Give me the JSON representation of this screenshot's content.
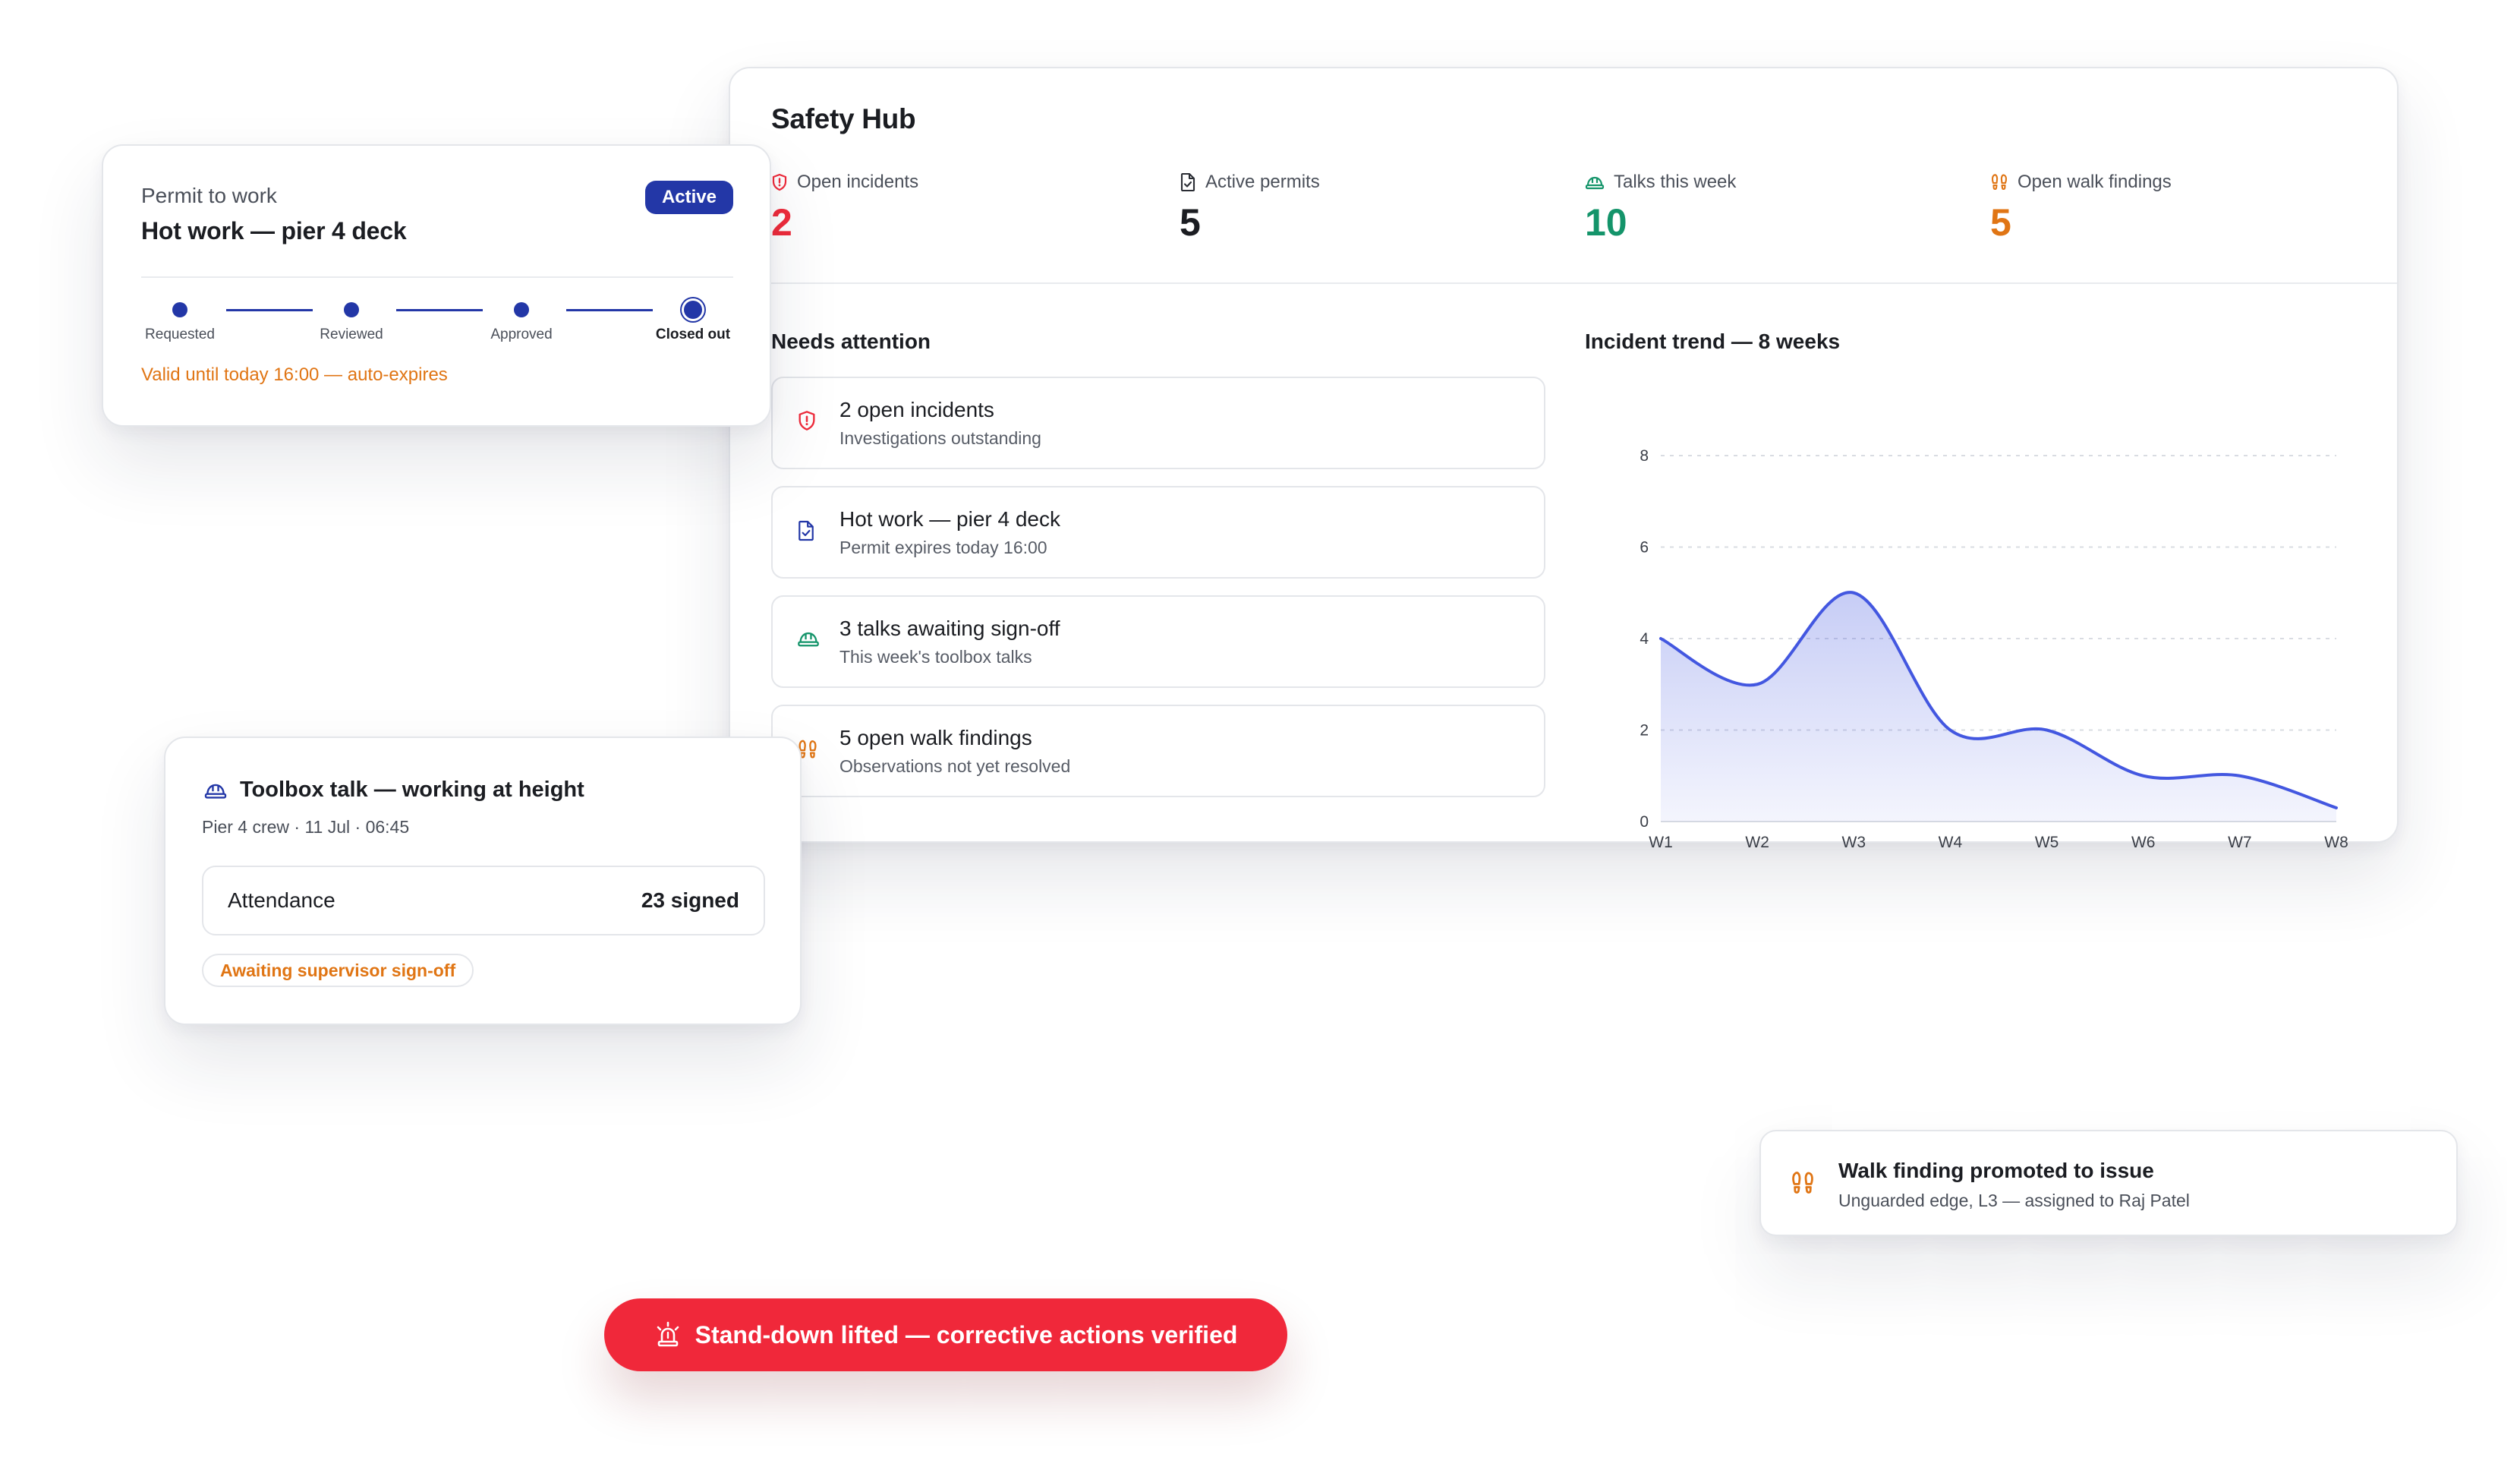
{
  "colors": {
    "accent": "#2337a7",
    "chart_line": "#4357e0",
    "incidents": "#ef2b3b",
    "talks": "#14946a",
    "findings": "#e07514",
    "toast": "#f0283a"
  },
  "hub": {
    "title": "Safety Hub",
    "stats": [
      {
        "label": "Open incidents",
        "value": "2",
        "icon": "shield-alert-icon"
      },
      {
        "label": "Active permits",
        "value": "5",
        "icon": "document-check-icon"
      },
      {
        "label": "Talks this week",
        "value": "10",
        "icon": "hard-hat-icon"
      },
      {
        "label": "Open walk findings",
        "value": "5",
        "icon": "footprints-icon"
      }
    ],
    "needs_attention_title": "Needs attention",
    "items": [
      {
        "title": "2 open incidents",
        "subtitle": "Investigations outstanding",
        "icon": "shield-alert-icon"
      },
      {
        "title": "Hot work — pier 4 deck",
        "subtitle": "Permit expires today 16:00",
        "icon": "document-check-icon"
      },
      {
        "title": "3 talks awaiting sign-off",
        "subtitle": "This week's toolbox talks",
        "icon": "hard-hat-icon"
      },
      {
        "title": "5 open walk findings",
        "subtitle": "Observations not yet resolved",
        "icon": "footprints-icon"
      }
    ],
    "trend_title": "Incident trend — 8 weeks"
  },
  "chart_data": {
    "type": "area",
    "title": "Incident trend — 8 weeks",
    "categories": [
      "W1",
      "W2",
      "W3",
      "W4",
      "W5",
      "W6",
      "W7",
      "W8"
    ],
    "values": [
      4,
      3,
      5,
      2,
      2,
      1,
      1,
      0.3
    ],
    "ylim": [
      0,
      8
    ],
    "yticks": [
      0,
      2,
      4,
      6,
      8
    ],
    "grid": true
  },
  "permit": {
    "eyebrow": "Permit to work",
    "title": "Hot work — pier 4 deck",
    "status": "Active",
    "steps": [
      "Requested",
      "Reviewed",
      "Approved",
      "Closed out"
    ],
    "current_step": "Closed out",
    "validity": "Valid until today 16:00 — auto-expires"
  },
  "toolbox": {
    "title": "Toolbox talk — working at height",
    "meta": "Pier 4 crew · 11 Jul · 06:45",
    "attendance_label": "Attendance",
    "attendance_value": "23 signed",
    "status": "Awaiting supervisor sign-off",
    "icon": "hard-hat-icon"
  },
  "walk_finding": {
    "title": "Walk finding promoted to issue",
    "subtitle": "Unguarded edge, L3 — assigned to Raj Patel",
    "icon": "footprints-icon"
  },
  "toast": {
    "text": "Stand-down lifted — corrective actions verified",
    "icon": "siren-icon"
  }
}
